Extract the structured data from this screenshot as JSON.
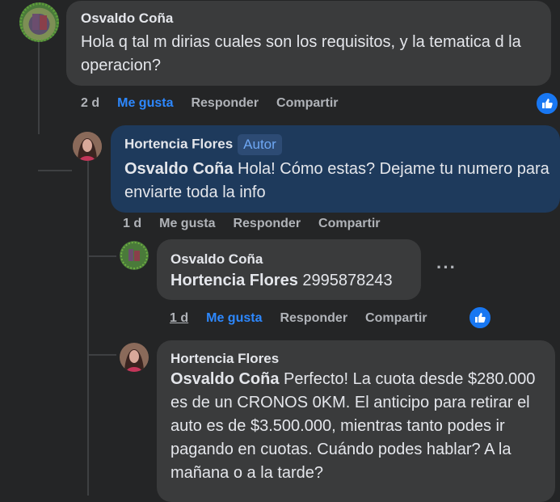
{
  "comments": [
    {
      "author": "Osvaldo Coña",
      "text": "Hola q tal m dirias cuales son los requisitos, y la tematica d la operacion?",
      "time": "2 d",
      "like": "Me gusta",
      "reply": "Responder",
      "share": "Compartir"
    },
    {
      "author": "Hortencia Flores",
      "badge": "Autor",
      "mention": "Osvaldo Coña",
      "text": "Hola! Cómo estas? Dejame tu numero para enviarte toda la info",
      "time": "1 d",
      "like": "Me gusta",
      "reply": "Responder",
      "share": "Compartir"
    },
    {
      "author": "Osvaldo Coña",
      "mention": "Hortencia Flores",
      "text": "2995878243",
      "time": "1 d",
      "like": "Me gusta",
      "reply": "Responder",
      "share": "Compartir",
      "more": "···"
    },
    {
      "author": "Hortencia Flores",
      "mention": "Osvaldo Coña",
      "text": "Perfecto! La cuota desde $280.000 es de un CRONOS 0KM. El anticipo para retirar el auto es de $3.500.000, mientras tanto podes ir pagando en cuotas. Cuándo podes hablar? A la mañana o a la tarde?"
    }
  ],
  "icons": {
    "reaction": "like-reaction-icon",
    "more": "more-options-icon"
  },
  "colors": {
    "background": "#242526",
    "bubble": "#3a3b3c",
    "author_bubble": "#1e3a5c",
    "link": "#2d88ff",
    "muted": "#b0b3b8"
  }
}
